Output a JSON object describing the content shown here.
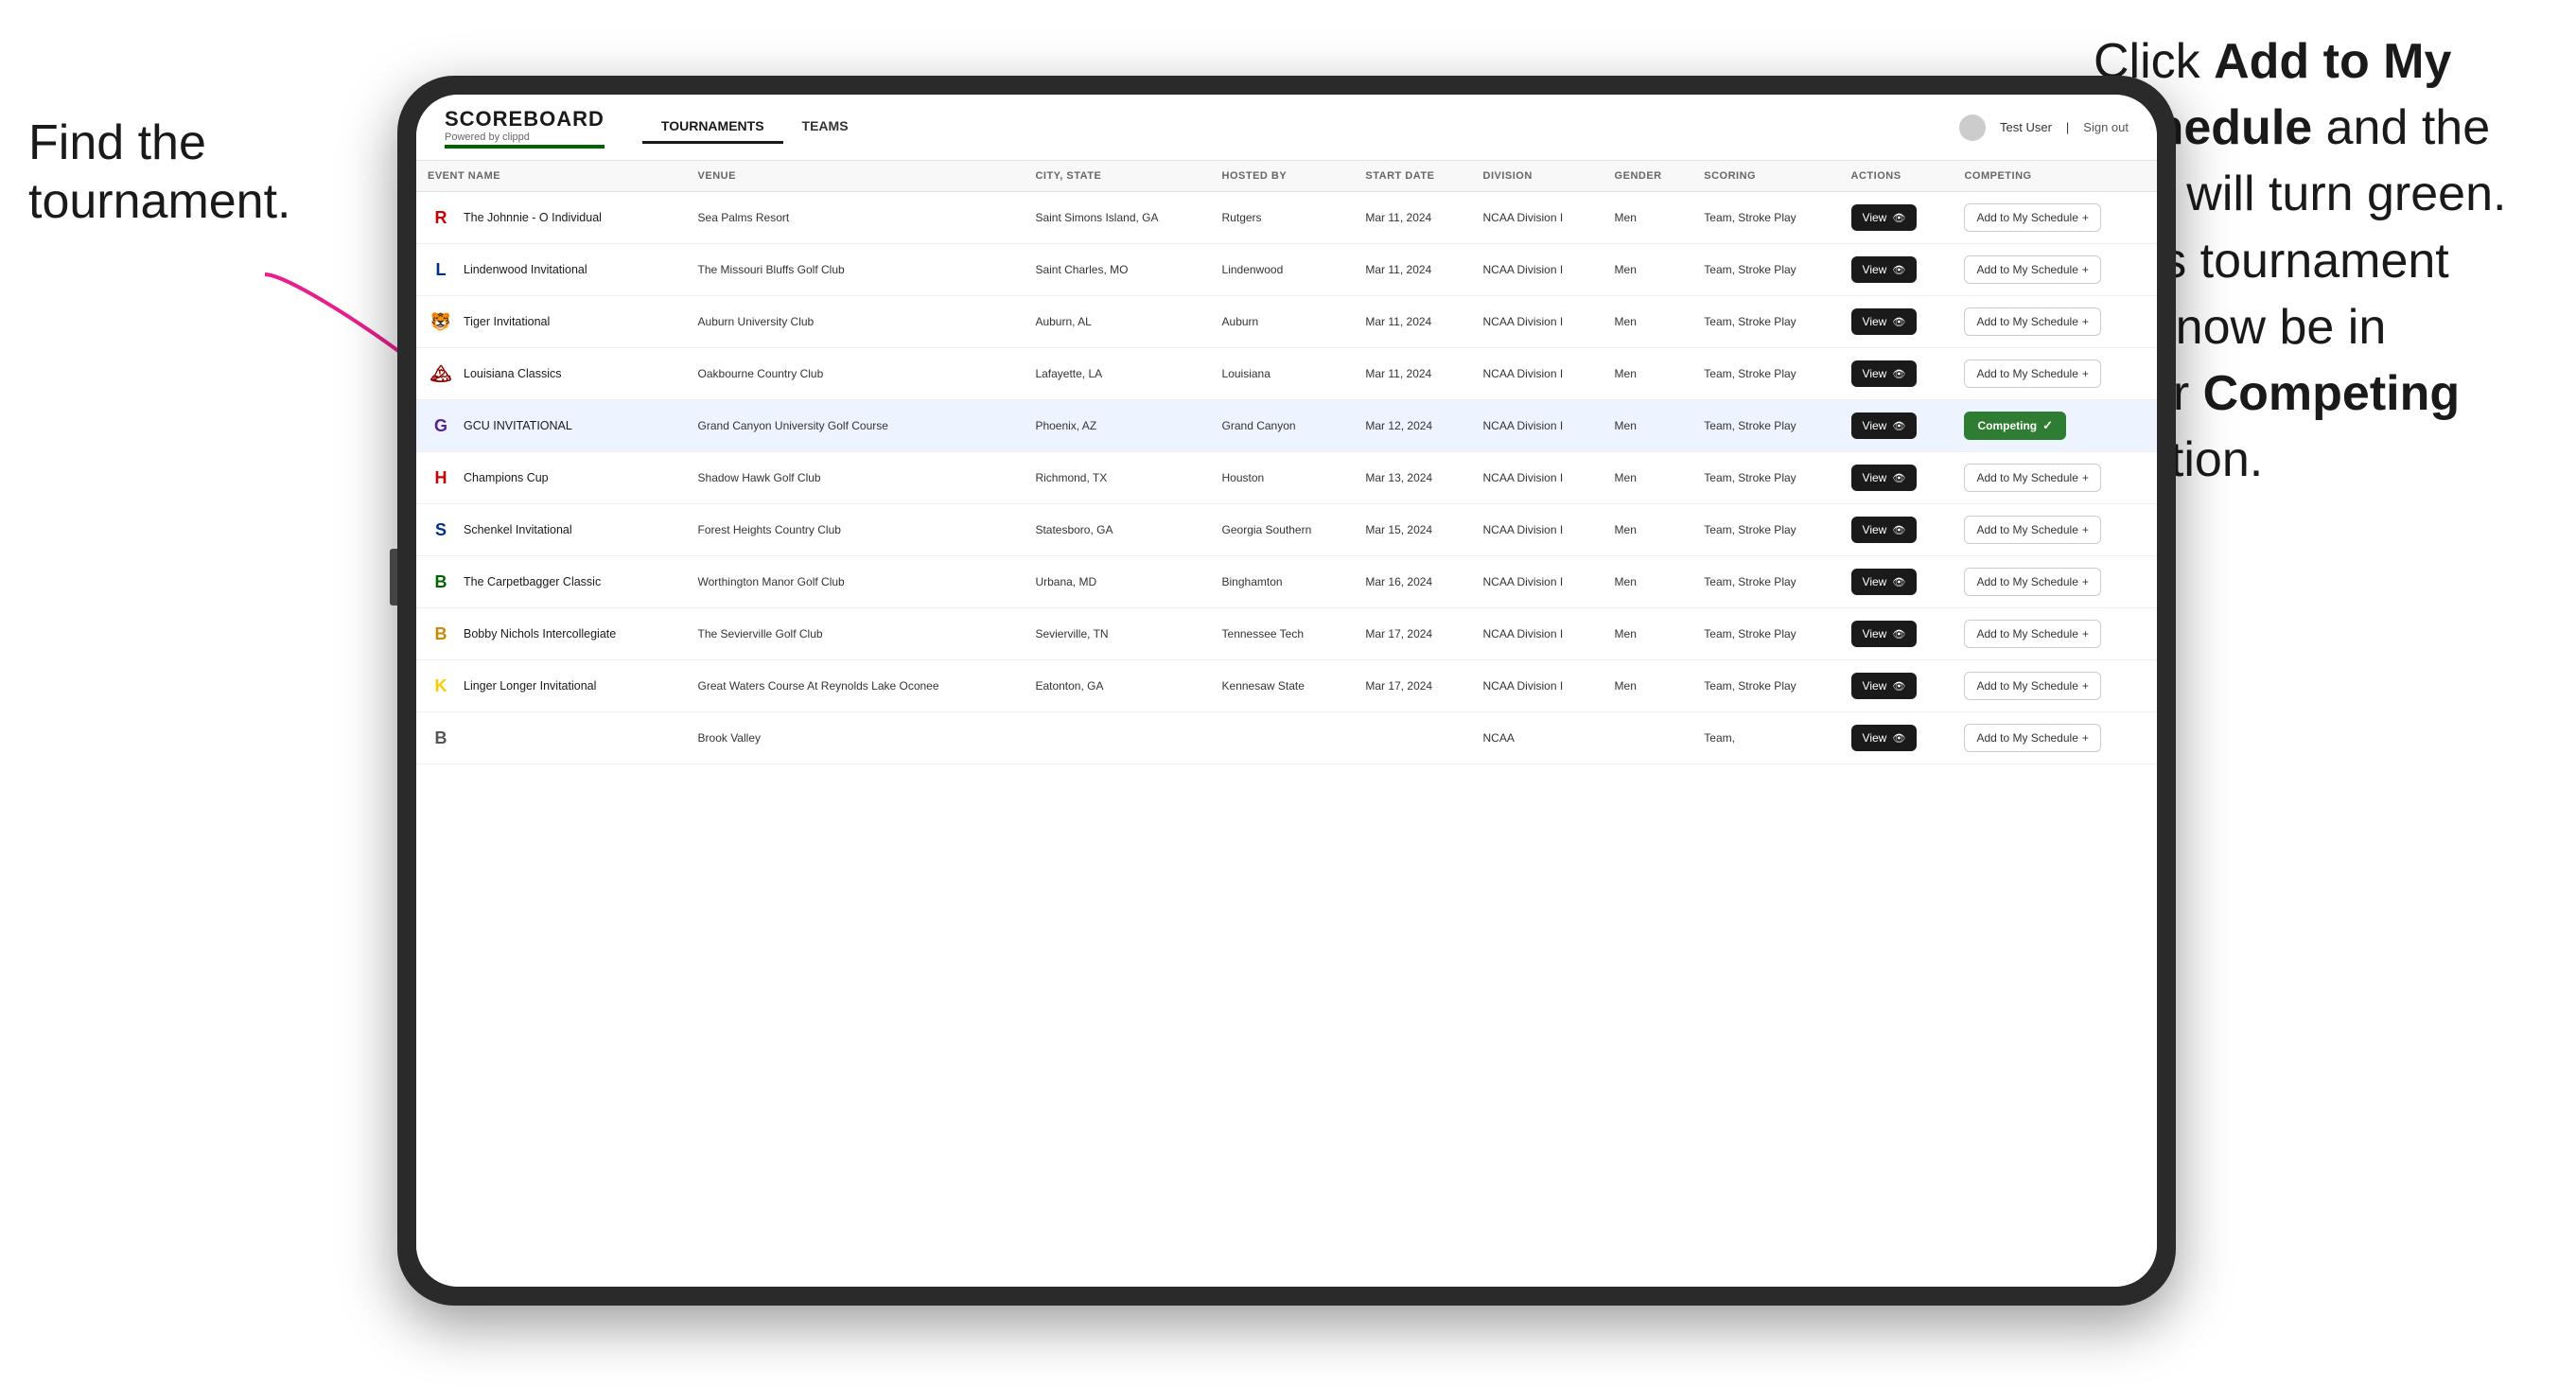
{
  "annotations": {
    "left_title": "Find the\ntournament.",
    "right_title_part1": "Click ",
    "right_bold1": "Add to My\nSchedule",
    "right_title_part2": " and the\nbox will turn green.\nThis tournament\nwill now be in\nyour ",
    "right_bold2": "Competing",
    "right_title_part3": "\nsection."
  },
  "header": {
    "logo": "SCOREBOARD",
    "logo_sub": "Powered by clippd",
    "nav_tabs": [
      {
        "label": "TOURNAMENTS",
        "active": true
      },
      {
        "label": "TEAMS",
        "active": false
      }
    ],
    "user": "Test User",
    "sign_out": "Sign out"
  },
  "table": {
    "columns": [
      "EVENT NAME",
      "VENUE",
      "CITY, STATE",
      "HOSTED BY",
      "START DATE",
      "DIVISION",
      "GENDER",
      "SCORING",
      "ACTIONS",
      "COMPETING"
    ],
    "rows": [
      {
        "logo_char": "R",
        "logo_color": "#cc0000",
        "event_name": "The Johnnie - O Individual",
        "venue": "Sea Palms Resort",
        "city_state": "Saint Simons Island, GA",
        "hosted_by": "Rutgers",
        "start_date": "Mar 11, 2024",
        "division": "NCAA Division I",
        "gender": "Men",
        "scoring": "Team, Stroke Play",
        "status": "add",
        "highlighted": false
      },
      {
        "logo_char": "L",
        "logo_color": "#003087",
        "event_name": "Lindenwood Invitational",
        "venue": "The Missouri Bluffs Golf Club",
        "city_state": "Saint Charles, MO",
        "hosted_by": "Lindenwood",
        "start_date": "Mar 11, 2024",
        "division": "NCAA Division I",
        "gender": "Men",
        "scoring": "Team, Stroke Play",
        "status": "add",
        "highlighted": false
      },
      {
        "logo_char": "🐯",
        "logo_color": "#ff8200",
        "event_name": "Tiger Invitational",
        "venue": "Auburn University Club",
        "city_state": "Auburn, AL",
        "hosted_by": "Auburn",
        "start_date": "Mar 11, 2024",
        "division": "NCAA Division I",
        "gender": "Men",
        "scoring": "Team, Stroke Play",
        "status": "add",
        "highlighted": false
      },
      {
        "logo_char": "🏔",
        "logo_color": "#8b0000",
        "event_name": "Louisiana Classics",
        "venue": "Oakbourne Country Club",
        "city_state": "Lafayette, LA",
        "hosted_by": "Louisiana",
        "start_date": "Mar 11, 2024",
        "division": "NCAA Division I",
        "gender": "Men",
        "scoring": "Team, Stroke Play",
        "status": "add",
        "highlighted": false
      },
      {
        "logo_char": "G",
        "logo_color": "#522398",
        "event_name": "GCU INVITATIONAL",
        "venue": "Grand Canyon University Golf Course",
        "city_state": "Phoenix, AZ",
        "hosted_by": "Grand Canyon",
        "start_date": "Mar 12, 2024",
        "division": "NCAA Division I",
        "gender": "Men",
        "scoring": "Team, Stroke Play",
        "status": "competing",
        "highlighted": true
      },
      {
        "logo_char": "H",
        "logo_color": "#cc0000",
        "event_name": "Champions Cup",
        "venue": "Shadow Hawk Golf Club",
        "city_state": "Richmond, TX",
        "hosted_by": "Houston",
        "start_date": "Mar 13, 2024",
        "division": "NCAA Division I",
        "gender": "Men",
        "scoring": "Team, Stroke Play",
        "status": "add",
        "highlighted": false
      },
      {
        "logo_char": "S",
        "logo_color": "#003087",
        "event_name": "Schenkel Invitational",
        "venue": "Forest Heights Country Club",
        "city_state": "Statesboro, GA",
        "hosted_by": "Georgia Southern",
        "start_date": "Mar 15, 2024",
        "division": "NCAA Division I",
        "gender": "Men",
        "scoring": "Team, Stroke Play",
        "status": "add",
        "highlighted": false
      },
      {
        "logo_char": "B",
        "logo_color": "#006400",
        "event_name": "The Carpetbagger Classic",
        "venue": "Worthington Manor Golf Club",
        "city_state": "Urbana, MD",
        "hosted_by": "Binghamton",
        "start_date": "Mar 16, 2024",
        "division": "NCAA Division I",
        "gender": "Men",
        "scoring": "Team, Stroke Play",
        "status": "add",
        "highlighted": false
      },
      {
        "logo_char": "B",
        "logo_color": "#cc8800",
        "event_name": "Bobby Nichols Intercollegiate",
        "venue": "The Sevierville Golf Club",
        "city_state": "Sevierville, TN",
        "hosted_by": "Tennessee Tech",
        "start_date": "Mar 17, 2024",
        "division": "NCAA Division I",
        "gender": "Men",
        "scoring": "Team, Stroke Play",
        "status": "add",
        "highlighted": false
      },
      {
        "logo_char": "K",
        "logo_color": "#ffcc00",
        "event_name": "Linger Longer Invitational",
        "venue": "Great Waters Course At Reynolds Lake Oconee",
        "city_state": "Eatonton, GA",
        "hosted_by": "Kennesaw State",
        "start_date": "Mar 17, 2024",
        "division": "NCAA Division I",
        "gender": "Men",
        "scoring": "Team, Stroke Play",
        "status": "add",
        "highlighted": false
      },
      {
        "logo_char": "B",
        "logo_color": "#555",
        "event_name": "",
        "venue": "Brook Valley",
        "city_state": "",
        "hosted_by": "",
        "start_date": "",
        "division": "NCAA",
        "gender": "",
        "scoring": "Team,",
        "status": "add",
        "highlighted": false
      }
    ],
    "add_label": "Add to My Schedule",
    "add_plus": "+",
    "competing_label": "Competing",
    "competing_check": "✓",
    "view_label": "View",
    "view_icon": "👁"
  }
}
